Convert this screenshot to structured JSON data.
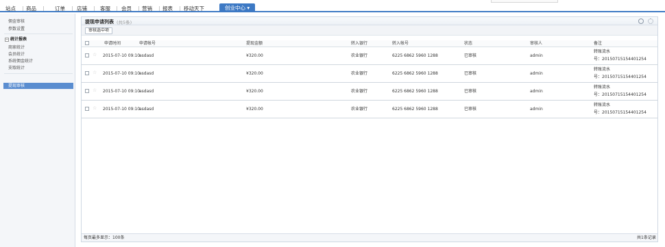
{
  "nav": {
    "items": [
      "站点",
      "商品",
      "订单",
      "店铺",
      "客服",
      "会员",
      "营销",
      "报表",
      "移动天下"
    ],
    "active": "创业中心 ▾"
  },
  "sidebar": {
    "items": [
      "佣金审核",
      "参数设置"
    ],
    "group": "统计报表",
    "group_toggle": "−",
    "sub_items": [
      "商家统计",
      "会员统计",
      "系统佣金统计",
      "支取统计"
    ],
    "active": "提现审核"
  },
  "panel": {
    "title": "提现申请列表",
    "count": "(共5条)",
    "audit_button": "审核选中项"
  },
  "table": {
    "headers": [
      "申请时间",
      "申请帐号",
      "提现金额",
      "转入银行",
      "转入帐号",
      "状态",
      "审核人",
      "备注"
    ],
    "rows": [
      {
        "time": "2015-07-10 09:10",
        "account": "asdasd",
        "amount": "¥320.00",
        "bank": "农业银行",
        "bank_account": "6225 6862 5960 1288",
        "status": "已审核",
        "auditor": "admin",
        "note1": "转账流水",
        "note2": "号：20150715154401254"
      },
      {
        "time": "2015-07-10 09:10",
        "account": "asdasd",
        "amount": "¥320.00",
        "bank": "农业银行",
        "bank_account": "6225 6862 5960 1288",
        "status": "已审核",
        "auditor": "admin",
        "note1": "转账流水",
        "note2": "号：20150715154401254"
      },
      {
        "time": "2015-07-10 09:10",
        "account": "asdasd",
        "amount": "¥320.00",
        "bank": "农业银行",
        "bank_account": "6225 6862 5960 1288",
        "status": "已审核",
        "auditor": "admin",
        "note1": "转账流水",
        "note2": "号：20150715154401254"
      },
      {
        "time": "2015-07-10 09:10",
        "account": "asdasd",
        "amount": "¥320.00",
        "bank": "农业银行",
        "bank_account": "6225 6862 5960 1288",
        "status": "已审核",
        "auditor": "admin",
        "note1": "转账流水",
        "note2": "号：20150715154401254"
      }
    ]
  },
  "footer": {
    "per_page": "每页最多显示：100条",
    "total": "共1条记录"
  },
  "colors": {
    "accent": "#3d79c4",
    "sidebar_active": "#5a8dd0"
  },
  "icons": [
    "refresh-icon",
    "settings-icon",
    "star-icon"
  ]
}
